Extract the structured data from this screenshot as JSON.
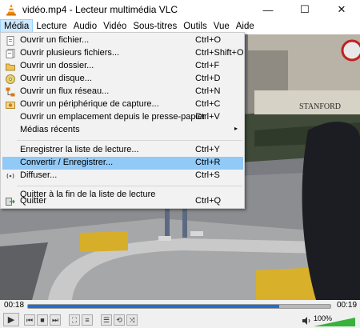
{
  "window": {
    "title": "vidéo.mp4 - Lecteur multimédia VLC",
    "minimize": "—",
    "maximize": "☐",
    "close": "✕"
  },
  "menubar": {
    "items": [
      "Média",
      "Lecture",
      "Audio",
      "Vidéo",
      "Sous-titres",
      "Outils",
      "Vue",
      "Aide"
    ],
    "active": "Média"
  },
  "media_menu": {
    "items": [
      {
        "label": "Ouvrir un fichier...",
        "shortcut": "Ctrl+O",
        "icon": "file-icon"
      },
      {
        "label": "Ouvrir plusieurs fichiers...",
        "shortcut": "Ctrl+Shift+O",
        "icon": "files-icon"
      },
      {
        "label": "Ouvrir un dossier...",
        "shortcut": "Ctrl+F",
        "icon": "folder-icon"
      },
      {
        "label": "Ouvrir un disque...",
        "shortcut": "Ctrl+D",
        "icon": "disc-icon"
      },
      {
        "label": "Ouvrir un flux réseau...",
        "shortcut": "Ctrl+N",
        "icon": "network-icon"
      },
      {
        "label": "Ouvrir un périphérique de capture...",
        "shortcut": "Ctrl+C",
        "icon": "capture-icon"
      },
      {
        "label": "Ouvrir un emplacement depuis le presse-papier",
        "shortcut": "Ctrl+V",
        "icon": ""
      },
      {
        "label": "Médias récents",
        "shortcut": "",
        "icon": "",
        "submenu": true
      },
      {
        "label": "Enregistrer la liste de lecture...",
        "shortcut": "Ctrl+Y",
        "icon": ""
      },
      {
        "label": "Convertir / Enregistrer...",
        "shortcut": "Ctrl+R",
        "icon": "",
        "highlighted": true
      },
      {
        "label": "Diffuser...",
        "shortcut": "Ctrl+S",
        "icon": "stream-icon"
      },
      {
        "label": "Quitter à la fin de la liste de lecture",
        "shortcut": "",
        "icon": ""
      },
      {
        "label": "Quitter",
        "shortcut": "Ctrl+Q",
        "icon": "exit-icon"
      }
    ],
    "submenu_arrow": "▸"
  },
  "controls": {
    "elapsed": "00:18",
    "total": "00:19",
    "progress_fraction": 0.83,
    "volume": "100%",
    "volume_fraction": 1.0,
    "buttons": [
      {
        "name": "play-button",
        "glyph": "▶"
      },
      {
        "name": "previous-button",
        "glyph": "⏮"
      },
      {
        "name": "stop-button",
        "glyph": "■"
      },
      {
        "name": "next-button",
        "glyph": "⏭"
      },
      {
        "name": "fullscreen-button",
        "glyph": "⛶"
      },
      {
        "name": "extended-settings-button",
        "glyph": "≡"
      },
      {
        "name": "playlist-button",
        "glyph": "☰"
      },
      {
        "name": "loop-button",
        "glyph": "⟲"
      },
      {
        "name": "random-button",
        "glyph": "⤨"
      }
    ]
  },
  "video": {
    "sign_text": "STANFORD"
  },
  "colors": {
    "menu_highlight": "#91c9f7",
    "menubar_active": "#cce8ff",
    "seek_fill": "#1e6fd0",
    "volume_green": "#38b23a"
  }
}
